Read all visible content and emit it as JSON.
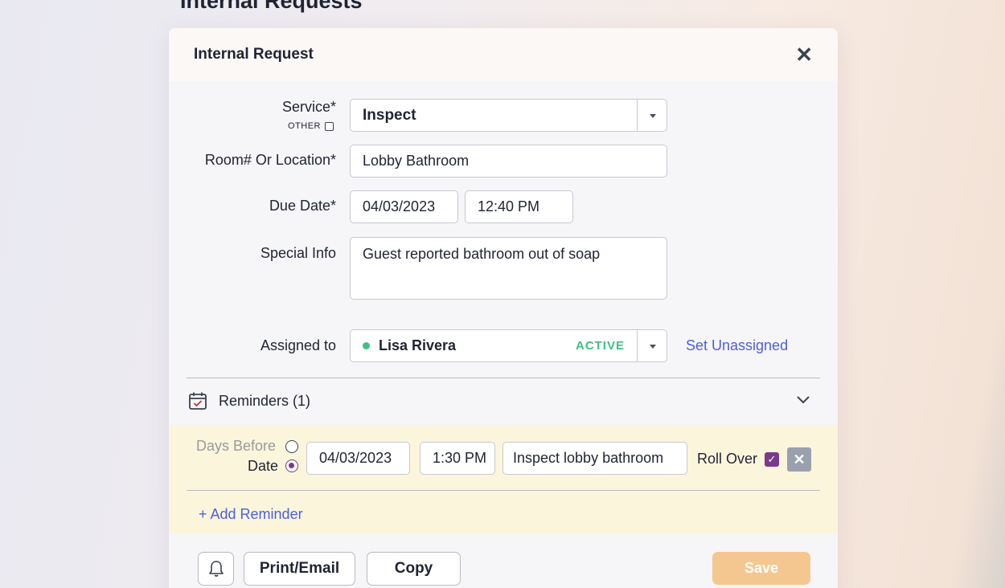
{
  "page": {
    "heading": "Internal Requests"
  },
  "modal": {
    "title": "Internal Request",
    "close_icon": "close-icon",
    "service": {
      "label": "Service*",
      "other_label": "OTHER",
      "value": "Inspect"
    },
    "room": {
      "label": "Room# Or Location*",
      "value": "Lobby Bathroom"
    },
    "due_date": {
      "label": "Due Date*",
      "date": "04/03/2023",
      "time": "12:40 PM"
    },
    "special_info": {
      "label": "Special Info",
      "value": "Guest reported bathroom out of soap"
    },
    "assigned": {
      "label": "Assigned to",
      "name": "Lisa Rivera",
      "status": "ACTIVE",
      "status_color": "#3fbf84",
      "unassign_link": "Set Unassigned"
    },
    "reminders": {
      "title": "Reminders (1)",
      "icon": "calendar-check-icon",
      "item": {
        "days_before_label": "Days Before",
        "date_label": "Date",
        "date": "04/03/2023",
        "time": "1:30 PM",
        "text": "Inspect lobby bathroom",
        "roll_over_label": "Roll Over",
        "roll_over_checked": true
      },
      "add_label": "+ Add Reminder"
    },
    "footer": {
      "bell_icon": "bell-icon",
      "print_label": "Print/Email",
      "copy_label": "Copy",
      "save_label": "Save"
    }
  },
  "colors": {
    "accent": "#4d5ee6",
    "checkbox": "#7a3a8a",
    "save": "#f5c790",
    "reminder_bg": "#fbf5dc"
  }
}
